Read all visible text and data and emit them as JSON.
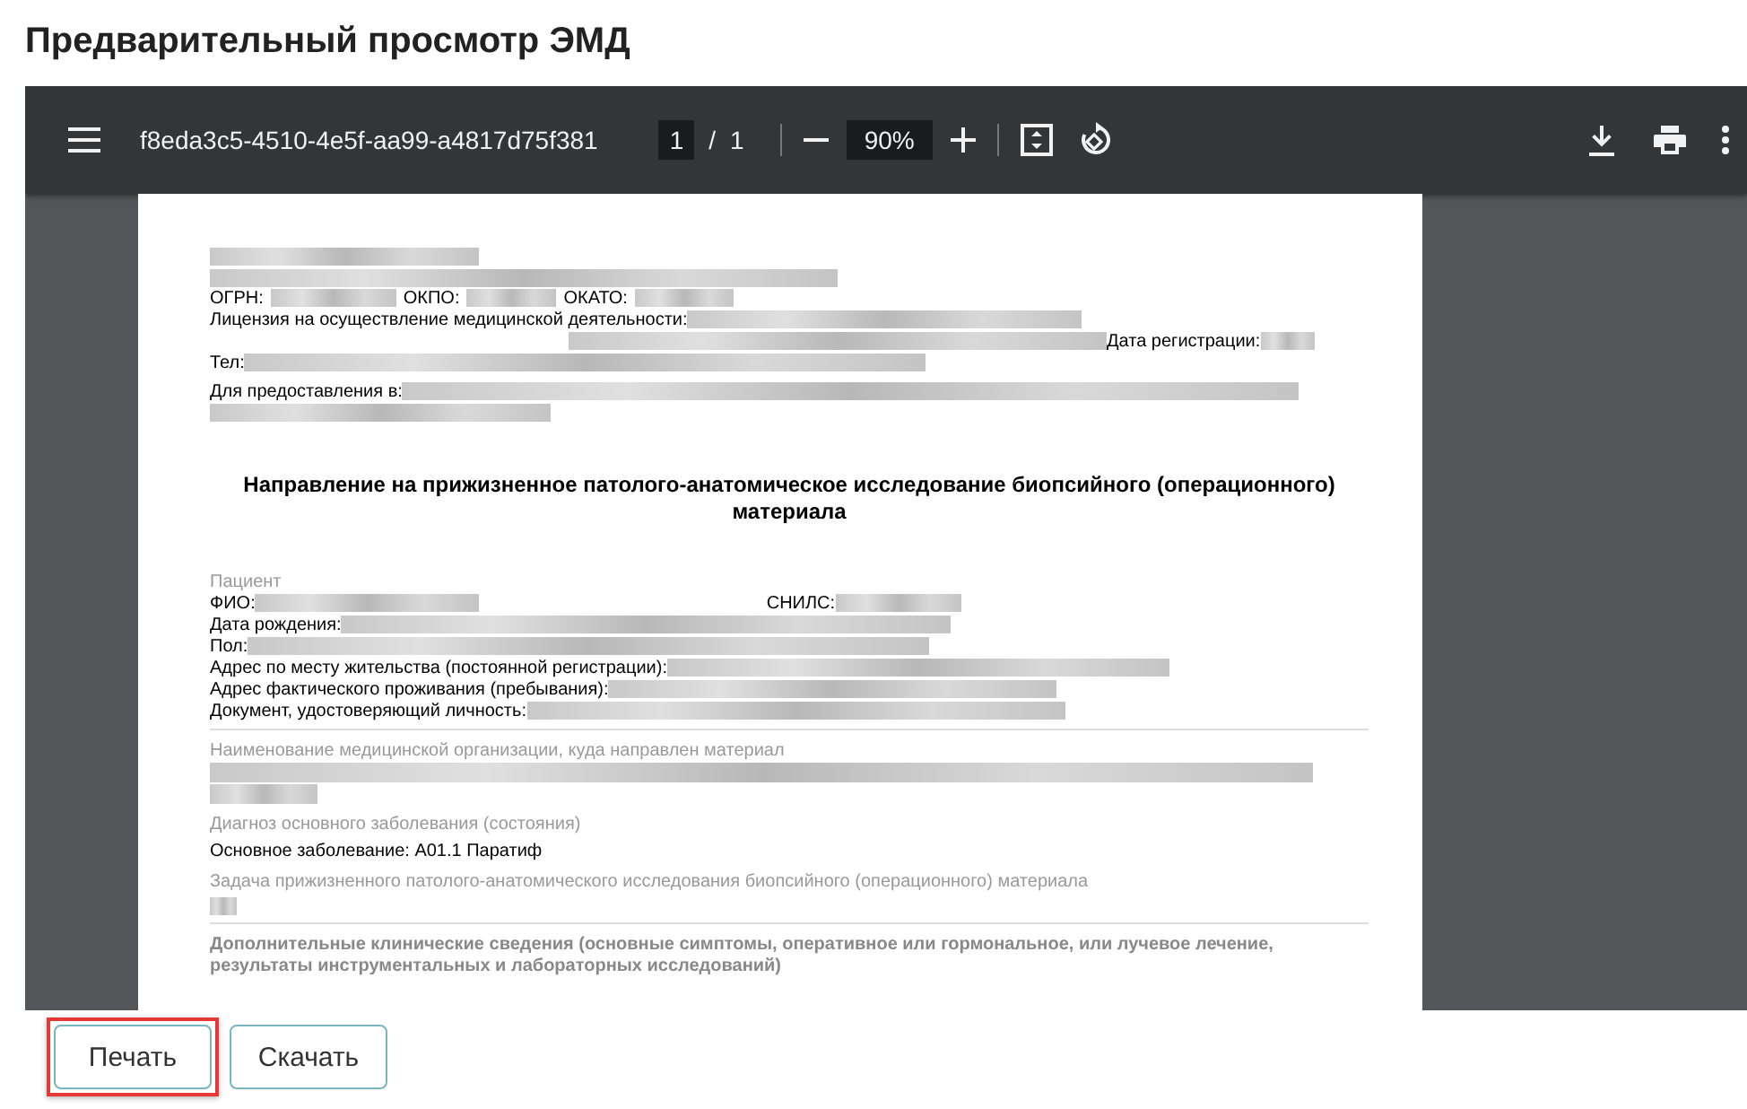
{
  "title": "Предварительный просмотр ЭМД",
  "viewer": {
    "filename": "f8eda3c5-4510-4e5f-aa99-a4817d75f381",
    "page_current": "1",
    "page_separator": "/",
    "page_total": "1",
    "zoom": "90%"
  },
  "document": [
    {
      "kind": "redacted"
    },
    {
      "kind": "field_row",
      "texts": [
        "ОГРН:",
        "ОКПО:",
        "ОКАТО:"
      ]
    },
    {
      "kind": "field",
      "text": "Лицензия на осуществление медицинской деятельности:"
    },
    {
      "kind": "field_right",
      "text": "Дата регистрации:"
    },
    {
      "kind": "field",
      "text": "Тел:"
    },
    {
      "kind": "field_long",
      "text": "Для предоставления в:"
    },
    {
      "kind": "heading",
      "text": "Направление на прижизненное патолого-анатомическое исследование биопсийного (операционного) материала"
    },
    {
      "kind": "label",
      "text": "Пациент"
    },
    {
      "kind": "field_pair",
      "texts": [
        "ФИО:",
        "СНИЛС:"
      ]
    },
    {
      "kind": "field",
      "text": "Дата рождения:"
    },
    {
      "kind": "field",
      "text": "Пол:"
    },
    {
      "kind": "field",
      "text": "Адрес по месту жительства (постоянной регистрации):"
    },
    {
      "kind": "field",
      "text": "Адрес фактического проживания (пребывания):"
    },
    {
      "kind": "field",
      "text": "Документ, удостоверяющий личность:"
    },
    {
      "kind": "divider"
    },
    {
      "kind": "label",
      "text": "Наименование медицинской организации, куда направлен материал"
    },
    {
      "kind": "redacted_block"
    },
    {
      "kind": "label",
      "text": "Диагноз основного заболевания (состояния)"
    },
    {
      "kind": "value",
      "text": "Основное заболевание: A01.1 Паратиф"
    },
    {
      "kind": "label",
      "text": "Задача прижизненного патолого-анатомического исследования биопсийного (операционного) материала"
    },
    {
      "kind": "redacted_small"
    },
    {
      "kind": "divider"
    },
    {
      "kind": "section",
      "text": "Дополнительные клинические сведения (основные симптомы, оперативное или гормональное, или лучевое лечение, результаты инструментальных и лабораторных исследований)"
    }
  ],
  "buttons": [
    {
      "label": "Печать",
      "highlighted": true
    },
    {
      "label": "Скачать",
      "highlighted": false
    }
  ]
}
